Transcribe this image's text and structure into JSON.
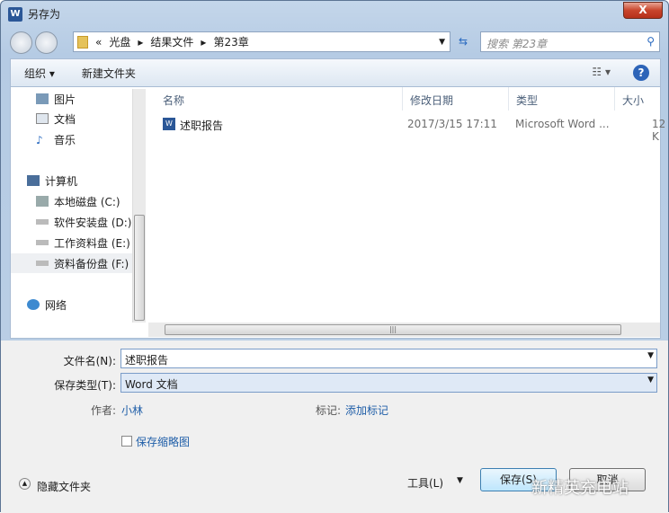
{
  "window": {
    "title": "另存为",
    "app_icon": "W",
    "close": "X"
  },
  "address": {
    "prefix": "«",
    "crumbs": [
      "光盘",
      "结果文件",
      "第23章"
    ],
    "search_placeholder": "搜索 第23章"
  },
  "toolbar": {
    "organize": "组织 ▾",
    "new_folder": "新建文件夹",
    "views": "☷ ▾",
    "help": "?"
  },
  "tree": [
    {
      "label": "图片",
      "icon": "pictures-icon"
    },
    {
      "label": "文档",
      "icon": "documents-icon"
    },
    {
      "label": "音乐",
      "icon": "music-icon"
    },
    {
      "label": "计算机",
      "icon": "computer-icon"
    },
    {
      "label": "本地磁盘 (C:)",
      "icon": "drive-icon"
    },
    {
      "label": "软件安装盘 (D:)",
      "icon": "drive-icon"
    },
    {
      "label": "工作资料盘 (E:)",
      "icon": "drive-icon"
    },
    {
      "label": "资料备份盘 (F:)",
      "icon": "drive-icon"
    },
    {
      "label": "网络",
      "icon": "network-icon"
    }
  ],
  "columns": [
    "名称",
    "修改日期",
    "类型",
    "大小"
  ],
  "files": [
    {
      "name": "述职报告",
      "date": "2017/3/15 17:11",
      "type": "Microsoft Word ...",
      "size": "12 K"
    }
  ],
  "form": {
    "filename_label": "文件名(N):",
    "filename": "述职报告",
    "type_label": "保存类型(T):",
    "type": "Word 文档",
    "author_label": "作者:",
    "author": "小林",
    "tags_label": "标记:",
    "tags": "添加标记",
    "thumbnail": "保存缩略图",
    "hide_folders": "隐藏文件夹",
    "tools": "工具(L)",
    "save": "保存(S)",
    "cancel": "取消"
  },
  "watermark": "新精英充电站"
}
